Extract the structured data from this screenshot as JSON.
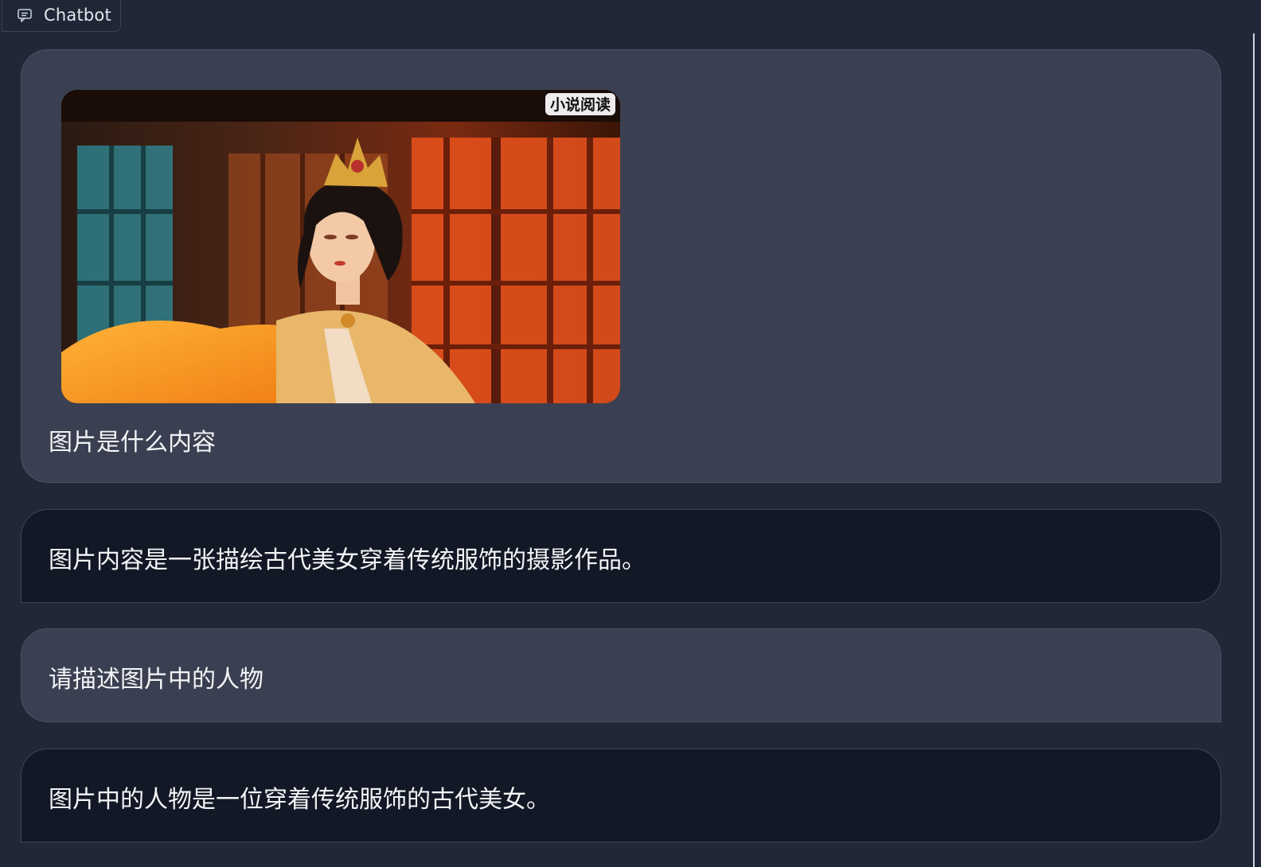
{
  "header": {
    "tab_label": "Chatbot",
    "tab_icon": "chat-bubble-icon"
  },
  "conversation": {
    "messages": [
      {
        "role": "user",
        "image": {
          "description_icon": "photo-icon",
          "watermark": "小说阅读"
        },
        "text": "图片是什么内容"
      },
      {
        "role": "bot",
        "text": "图片内容是一张描绘古代美女穿着传统服饰的摄影作品。"
      },
      {
        "role": "user",
        "text": "请描述图片中的人物"
      },
      {
        "role": "bot",
        "text": "图片中的人物是一位穿着传统服饰的古代美女。"
      }
    ]
  },
  "colors": {
    "background": "#202737",
    "user_bubble": "#3a4051",
    "bot_bubble": "#131826",
    "text": "#f3f4f6"
  }
}
